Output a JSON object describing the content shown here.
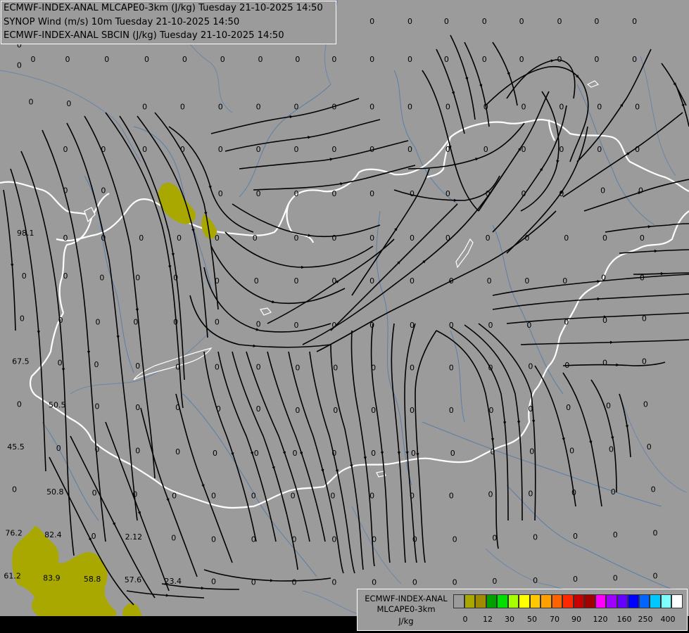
{
  "titles": [
    "ECMWF-INDEX-ANAL MLCAPE0-3km (J/kg) Tuesday 21-10-2025 14:50",
    "SYNOP Wind (m/s) 10m Tuesday 21-10-2025 14:50",
    "ECMWF-INDEX-ANAL SBCIN (J/kg) Tuesday 21-10-2025 14:50"
  ],
  "legend": {
    "name_line1": "ECMWF-INDEX-ANAL",
    "name_line2": "MLCAPE0-3km",
    "unit": "J/kg",
    "colors": [
      "#9b9b9b",
      "#a8a800",
      "#a08a00",
      "#00a000",
      "#00e000",
      "#a8ff00",
      "#ffff00",
      "#ffc800",
      "#ffa000",
      "#ff6400",
      "#ff2800",
      "#c80000",
      "#a00000",
      "#ff00ff",
      "#a000ff",
      "#6400ff",
      "#0000ff",
      "#0064ff",
      "#00c8ff",
      "#80ffff",
      "#ffffff"
    ],
    "ticks": [
      "0",
      "12",
      "30",
      "50",
      "70",
      "90",
      "120",
      "160",
      "250",
      "400"
    ]
  },
  "sbcin_labels": [
    {
      "t": "0",
      "p": [
        0.028,
        0.038
      ]
    },
    {
      "t": "0",
      "p": [
        0.028,
        0.075
      ]
    },
    {
      "t": "0",
      "p": [
        0.028,
        0.107
      ]
    },
    {
      "t": "0",
      "p": [
        0.048,
        0.098
      ]
    },
    {
      "t": "0",
      "p": [
        0.098,
        0.098
      ]
    },
    {
      "t": "0",
      "p": [
        0.155,
        0.098
      ]
    },
    {
      "t": "0",
      "p": [
        0.213,
        0.098
      ]
    },
    {
      "t": "0",
      "p": [
        0.268,
        0.098
      ]
    },
    {
      "t": "0",
      "p": [
        0.323,
        0.098
      ]
    },
    {
      "t": "0",
      "p": [
        0.378,
        0.098
      ]
    },
    {
      "t": "0",
      "p": [
        0.432,
        0.098
      ]
    },
    {
      "t": "0",
      "p": [
        0.485,
        0.098
      ]
    },
    {
      "t": "0",
      "p": [
        0.54,
        0.098
      ]
    },
    {
      "t": "0",
      "p": [
        0.595,
        0.098
      ]
    },
    {
      "t": "0",
      "p": [
        0.648,
        0.098
      ]
    },
    {
      "t": "0",
      "p": [
        0.703,
        0.098
      ]
    },
    {
      "t": "0",
      "p": [
        0.757,
        0.098
      ]
    },
    {
      "t": "0",
      "p": [
        0.812,
        0.098
      ]
    },
    {
      "t": "0",
      "p": [
        0.866,
        0.098
      ]
    },
    {
      "t": "0",
      "p": [
        0.921,
        0.098
      ]
    },
    {
      "t": "0",
      "p": [
        0.54,
        0.038
      ]
    },
    {
      "t": "0",
      "p": [
        0.595,
        0.038
      ]
    },
    {
      "t": "0",
      "p": [
        0.648,
        0.038
      ]
    },
    {
      "t": "0",
      "p": [
        0.703,
        0.038
      ]
    },
    {
      "t": "0",
      "p": [
        0.757,
        0.038
      ]
    },
    {
      "t": "0",
      "p": [
        0.812,
        0.038
      ]
    },
    {
      "t": "0",
      "p": [
        0.866,
        0.038
      ]
    },
    {
      "t": "0",
      "p": [
        0.921,
        0.038
      ]
    },
    {
      "t": "0",
      "p": [
        0.045,
        0.165
      ]
    },
    {
      "t": "0",
      "p": [
        0.1,
        0.168
      ]
    },
    {
      "t": "0",
      "p": [
        0.21,
        0.173
      ]
    },
    {
      "t": "0",
      "p": [
        0.265,
        0.173
      ]
    },
    {
      "t": "0",
      "p": [
        0.32,
        0.173
      ]
    },
    {
      "t": "0",
      "p": [
        0.375,
        0.173
      ]
    },
    {
      "t": "0",
      "p": [
        0.43,
        0.173
      ]
    },
    {
      "t": "0",
      "p": [
        0.485,
        0.173
      ]
    },
    {
      "t": "0",
      "p": [
        0.54,
        0.173
      ]
    },
    {
      "t": "0",
      "p": [
        0.595,
        0.173
      ]
    },
    {
      "t": "0",
      "p": [
        0.65,
        0.173
      ]
    },
    {
      "t": "0",
      "p": [
        0.705,
        0.173
      ]
    },
    {
      "t": "0",
      "p": [
        0.76,
        0.173
      ]
    },
    {
      "t": "0",
      "p": [
        0.815,
        0.173
      ]
    },
    {
      "t": "0",
      "p": [
        0.87,
        0.173
      ]
    },
    {
      "t": "0",
      "p": [
        0.925,
        0.173
      ]
    },
    {
      "t": "0",
      "p": [
        0.095,
        0.24
      ]
    },
    {
      "t": "0",
      "p": [
        0.15,
        0.24
      ]
    },
    {
      "t": "0",
      "p": [
        0.21,
        0.24
      ]
    },
    {
      "t": "0",
      "p": [
        0.265,
        0.24
      ]
    },
    {
      "t": "0",
      "p": [
        0.32,
        0.24
      ]
    },
    {
      "t": "0",
      "p": [
        0.375,
        0.24
      ]
    },
    {
      "t": "0",
      "p": [
        0.43,
        0.24
      ]
    },
    {
      "t": "0",
      "p": [
        0.485,
        0.24
      ]
    },
    {
      "t": "0",
      "p": [
        0.54,
        0.24
      ]
    },
    {
      "t": "0",
      "p": [
        0.595,
        0.24
      ]
    },
    {
      "t": "0",
      "p": [
        0.65,
        0.24
      ]
    },
    {
      "t": "0",
      "p": [
        0.705,
        0.24
      ]
    },
    {
      "t": "0",
      "p": [
        0.76,
        0.24
      ]
    },
    {
      "t": "0",
      "p": [
        0.815,
        0.24
      ]
    },
    {
      "t": "0",
      "p": [
        0.87,
        0.24
      ]
    },
    {
      "t": "0",
      "p": [
        0.925,
        0.24
      ]
    },
    {
      "t": "0",
      "p": [
        0.095,
        0.305
      ]
    },
    {
      "t": "0",
      "p": [
        0.15,
        0.305
      ]
    },
    {
      "t": "0",
      "p": [
        0.32,
        0.31
      ]
    },
    {
      "t": "0",
      "p": [
        0.375,
        0.31
      ]
    },
    {
      "t": "0",
      "p": [
        0.43,
        0.31
      ]
    },
    {
      "t": "0",
      "p": [
        0.485,
        0.31
      ]
    },
    {
      "t": "0",
      "p": [
        0.54,
        0.31
      ]
    },
    {
      "t": "0",
      "p": [
        0.598,
        0.31
      ]
    },
    {
      "t": "0",
      "p": [
        0.65,
        0.31
      ]
    },
    {
      "t": "0",
      "p": [
        0.708,
        0.31
      ]
    },
    {
      "t": "0",
      "p": [
        0.76,
        0.31
      ]
    },
    {
      "t": "0",
      "p": [
        0.815,
        0.31
      ]
    },
    {
      "t": "0",
      "p": [
        0.875,
        0.305
      ]
    },
    {
      "t": "0",
      "p": [
        0.93,
        0.305
      ]
    },
    {
      "t": "98.1",
      "p": [
        0.037,
        0.372
      ]
    },
    {
      "t": "0",
      "p": [
        0.095,
        0.38
      ]
    },
    {
      "t": "0",
      "p": [
        0.15,
        0.38
      ]
    },
    {
      "t": "0",
      "p": [
        0.205,
        0.38
      ]
    },
    {
      "t": "0",
      "p": [
        0.26,
        0.38
      ]
    },
    {
      "t": "0",
      "p": [
        0.315,
        0.38
      ]
    },
    {
      "t": "0",
      "p": [
        0.37,
        0.38
      ]
    },
    {
      "t": "0",
      "p": [
        0.43,
        0.38
      ]
    },
    {
      "t": "0",
      "p": [
        0.485,
        0.38
      ]
    },
    {
      "t": "0",
      "p": [
        0.54,
        0.38
      ]
    },
    {
      "t": "0",
      "p": [
        0.598,
        0.38
      ]
    },
    {
      "t": "0",
      "p": [
        0.65,
        0.38
      ]
    },
    {
      "t": "0",
      "p": [
        0.708,
        0.38
      ]
    },
    {
      "t": "0",
      "p": [
        0.765,
        0.38
      ]
    },
    {
      "t": "0",
      "p": [
        0.822,
        0.38
      ]
    },
    {
      "t": "0",
      "p": [
        0.878,
        0.38
      ]
    },
    {
      "t": "0",
      "p": [
        0.932,
        0.38
      ]
    },
    {
      "t": "0",
      "p": [
        0.035,
        0.44
      ]
    },
    {
      "t": "0",
      "p": [
        0.095,
        0.44
      ]
    },
    {
      "t": "0",
      "p": [
        0.148,
        0.443
      ]
    },
    {
      "t": "0",
      "p": [
        0.2,
        0.443
      ]
    },
    {
      "t": "0",
      "p": [
        0.255,
        0.443
      ]
    },
    {
      "t": "0",
      "p": [
        0.315,
        0.448
      ]
    },
    {
      "t": "0",
      "p": [
        0.372,
        0.448
      ]
    },
    {
      "t": "0",
      "p": [
        0.43,
        0.448
      ]
    },
    {
      "t": "0",
      "p": [
        0.485,
        0.448
      ]
    },
    {
      "t": "0",
      "p": [
        0.54,
        0.448
      ]
    },
    {
      "t": "0",
      "p": [
        0.598,
        0.448
      ]
    },
    {
      "t": "0",
      "p": [
        0.655,
        0.448
      ]
    },
    {
      "t": "0",
      "p": [
        0.71,
        0.448
      ]
    },
    {
      "t": "0",
      "p": [
        0.765,
        0.448
      ]
    },
    {
      "t": "0",
      "p": [
        0.82,
        0.448
      ]
    },
    {
      "t": "0",
      "p": [
        0.876,
        0.443
      ]
    },
    {
      "t": "0",
      "p": [
        0.932,
        0.443
      ]
    },
    {
      "t": "0",
      "p": [
        0.032,
        0.507
      ]
    },
    {
      "t": "0",
      "p": [
        0.088,
        0.51
      ]
    },
    {
      "t": "0",
      "p": [
        0.142,
        0.513
      ]
    },
    {
      "t": "0",
      "p": [
        0.197,
        0.513
      ]
    },
    {
      "t": "0",
      "p": [
        0.255,
        0.513
      ]
    },
    {
      "t": "0",
      "p": [
        0.315,
        0.513
      ]
    },
    {
      "t": "0",
      "p": [
        0.375,
        0.516
      ]
    },
    {
      "t": "0",
      "p": [
        0.43,
        0.518
      ]
    },
    {
      "t": "0",
      "p": [
        0.485,
        0.518
      ]
    },
    {
      "t": "0",
      "p": [
        0.54,
        0.518
      ]
    },
    {
      "t": "0",
      "p": [
        0.598,
        0.518
      ]
    },
    {
      "t": "0",
      "p": [
        0.655,
        0.518
      ]
    },
    {
      "t": "0",
      "p": [
        0.712,
        0.518
      ]
    },
    {
      "t": "0",
      "p": [
        0.768,
        0.518
      ]
    },
    {
      "t": "0",
      "p": [
        0.822,
        0.513
      ]
    },
    {
      "t": "0",
      "p": [
        0.878,
        0.51
      ]
    },
    {
      "t": "0",
      "p": [
        0.935,
        0.507
      ]
    },
    {
      "t": "67.5",
      "p": [
        0.03,
        0.575
      ]
    },
    {
      "t": "0",
      "p": [
        0.087,
        0.577
      ]
    },
    {
      "t": "0",
      "p": [
        0.14,
        0.58
      ]
    },
    {
      "t": "0",
      "p": [
        0.2,
        0.582
      ]
    },
    {
      "t": "0",
      "p": [
        0.258,
        0.584
      ]
    },
    {
      "t": "0",
      "p": [
        0.315,
        0.584
      ]
    },
    {
      "t": "0",
      "p": [
        0.375,
        0.584
      ]
    },
    {
      "t": "0",
      "p": [
        0.432,
        0.585
      ]
    },
    {
      "t": "0",
      "p": [
        0.487,
        0.585
      ]
    },
    {
      "t": "0",
      "p": [
        0.542,
        0.585
      ]
    },
    {
      "t": "0",
      "p": [
        0.598,
        0.585
      ]
    },
    {
      "t": "0",
      "p": [
        0.655,
        0.585
      ]
    },
    {
      "t": "0",
      "p": [
        0.712,
        0.585
      ]
    },
    {
      "t": "0",
      "p": [
        0.77,
        0.583
      ]
    },
    {
      "t": "0",
      "p": [
        0.823,
        0.581
      ]
    },
    {
      "t": "0",
      "p": [
        0.878,
        0.577
      ]
    },
    {
      "t": "0",
      "p": [
        0.935,
        0.575
      ]
    },
    {
      "t": "0",
      "p": [
        0.028,
        0.643
      ]
    },
    {
      "t": "50.5",
      "p": [
        0.083,
        0.644
      ]
    },
    {
      "t": "0",
      "p": [
        0.141,
        0.646
      ]
    },
    {
      "t": "0",
      "p": [
        0.2,
        0.648
      ]
    },
    {
      "t": "0",
      "p": [
        0.258,
        0.648
      ]
    },
    {
      "t": "0",
      "p": [
        0.317,
        0.65
      ]
    },
    {
      "t": "0",
      "p": [
        0.375,
        0.65
      ]
    },
    {
      "t": "0",
      "p": [
        0.432,
        0.652
      ]
    },
    {
      "t": "0",
      "p": [
        0.487,
        0.652
      ]
    },
    {
      "t": "0",
      "p": [
        0.542,
        0.652
      ]
    },
    {
      "t": "0",
      "p": [
        0.598,
        0.652
      ]
    },
    {
      "t": "0",
      "p": [
        0.655,
        0.652
      ]
    },
    {
      "t": "0",
      "p": [
        0.713,
        0.652
      ]
    },
    {
      "t": "0",
      "p": [
        0.77,
        0.65
      ]
    },
    {
      "t": "0",
      "p": [
        0.825,
        0.648
      ]
    },
    {
      "t": "0",
      "p": [
        0.883,
        0.645
      ]
    },
    {
      "t": "0",
      "p": [
        0.937,
        0.643
      ]
    },
    {
      "t": "45.5",
      "p": [
        0.023,
        0.71
      ]
    },
    {
      "t": "0",
      "p": [
        0.085,
        0.712
      ]
    },
    {
      "t": "0",
      "p": [
        0.141,
        0.714
      ]
    },
    {
      "t": "0",
      "p": [
        0.2,
        0.716
      ]
    },
    {
      "t": "0",
      "p": [
        0.258,
        0.718
      ]
    },
    {
      "t": "0",
      "p": [
        0.312,
        0.72
      ]
    },
    {
      "t": "0",
      "p": [
        0.372,
        0.72
      ]
    },
    {
      "t": "0",
      "p": [
        0.428,
        0.72
      ]
    },
    {
      "t": "0",
      "p": [
        0.485,
        0.72
      ]
    },
    {
      "t": "0",
      "p": [
        0.542,
        0.72
      ]
    },
    {
      "t": "0",
      "p": [
        0.6,
        0.72
      ]
    },
    {
      "t": "0",
      "p": [
        0.657,
        0.72
      ]
    },
    {
      "t": "0",
      "p": [
        0.715,
        0.718
      ]
    },
    {
      "t": "0",
      "p": [
        0.772,
        0.717
      ]
    },
    {
      "t": "0",
      "p": [
        0.83,
        0.716
      ]
    },
    {
      "t": "0",
      "p": [
        0.887,
        0.714
      ]
    },
    {
      "t": "0",
      "p": [
        0.942,
        0.71
      ]
    },
    {
      "t": "0",
      "p": [
        0.021,
        0.777
      ]
    },
    {
      "t": "50.8",
      "p": [
        0.08,
        0.781
      ]
    },
    {
      "t": "0",
      "p": [
        0.137,
        0.783
      ]
    },
    {
      "t": "0",
      "p": [
        0.196,
        0.785
      ]
    },
    {
      "t": "0",
      "p": [
        0.253,
        0.787
      ]
    },
    {
      "t": "0",
      "p": [
        0.31,
        0.787
      ]
    },
    {
      "t": "0",
      "p": [
        0.368,
        0.787
      ]
    },
    {
      "t": "0",
      "p": [
        0.425,
        0.787
      ]
    },
    {
      "t": "0",
      "p": [
        0.483,
        0.787
      ]
    },
    {
      "t": "0",
      "p": [
        0.54,
        0.787
      ]
    },
    {
      "t": "0",
      "p": [
        0.598,
        0.787
      ]
    },
    {
      "t": "0",
      "p": [
        0.655,
        0.787
      ]
    },
    {
      "t": "0",
      "p": [
        0.712,
        0.785
      ]
    },
    {
      "t": "0",
      "p": [
        0.77,
        0.784
      ]
    },
    {
      "t": "0",
      "p": [
        0.833,
        0.782
      ]
    },
    {
      "t": "0",
      "p": [
        0.89,
        0.781
      ]
    },
    {
      "t": "0",
      "p": [
        0.948,
        0.777
      ]
    },
    {
      "t": "76.2",
      "p": [
        0.02,
        0.846
      ]
    },
    {
      "t": "82.4",
      "p": [
        0.077,
        0.849
      ]
    },
    {
      "t": "0",
      "p": [
        0.136,
        0.851
      ]
    },
    {
      "t": "2.12",
      "p": [
        0.194,
        0.852
      ]
    },
    {
      "t": "0",
      "p": [
        0.252,
        0.854
      ]
    },
    {
      "t": "0",
      "p": [
        0.31,
        0.856
      ]
    },
    {
      "t": "0",
      "p": [
        0.368,
        0.856
      ]
    },
    {
      "t": "0",
      "p": [
        0.427,
        0.856
      ]
    },
    {
      "t": "0",
      "p": [
        0.485,
        0.856
      ]
    },
    {
      "t": "0",
      "p": [
        0.543,
        0.856
      ]
    },
    {
      "t": "0",
      "p": [
        0.602,
        0.856
      ]
    },
    {
      "t": "0",
      "p": [
        0.66,
        0.856
      ]
    },
    {
      "t": "0",
      "p": [
        0.718,
        0.854
      ]
    },
    {
      "t": "0",
      "p": [
        0.777,
        0.853
      ]
    },
    {
      "t": "0",
      "p": [
        0.835,
        0.851
      ]
    },
    {
      "t": "0",
      "p": [
        0.893,
        0.849
      ]
    },
    {
      "t": "0",
      "p": [
        0.951,
        0.846
      ]
    },
    {
      "t": "61.2",
      "p": [
        0.018,
        0.914
      ]
    },
    {
      "t": "83.9",
      "p": [
        0.075,
        0.917
      ]
    },
    {
      "t": "58.8",
      "p": [
        0.134,
        0.919
      ]
    },
    {
      "t": "57.6",
      "p": [
        0.193,
        0.92
      ]
    },
    {
      "t": "23.4",
      "p": [
        0.251,
        0.922
      ]
    },
    {
      "t": "0",
      "p": [
        0.31,
        0.923
      ]
    },
    {
      "t": "0",
      "p": [
        0.368,
        0.924
      ]
    },
    {
      "t": "0",
      "p": [
        0.427,
        0.924
      ]
    },
    {
      "t": "0",
      "p": [
        0.485,
        0.924
      ]
    },
    {
      "t": "0",
      "p": [
        0.543,
        0.924
      ]
    },
    {
      "t": "0",
      "p": [
        0.602,
        0.924
      ]
    },
    {
      "t": "0",
      "p": [
        0.66,
        0.924
      ]
    },
    {
      "t": "0",
      "p": [
        0.718,
        0.922
      ]
    },
    {
      "t": "0",
      "p": [
        0.777,
        0.921
      ]
    },
    {
      "t": "0",
      "p": [
        0.835,
        0.919
      ]
    },
    {
      "t": "0",
      "p": [
        0.893,
        0.917
      ]
    },
    {
      "t": "0",
      "p": [
        0.951,
        0.914
      ]
    }
  ]
}
